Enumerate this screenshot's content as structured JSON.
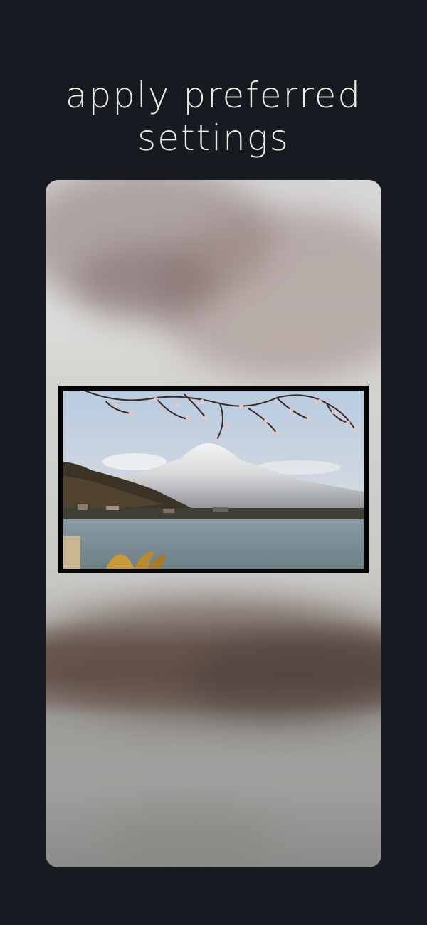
{
  "headline": {
    "line1": "apply preferred",
    "line2": "settings"
  },
  "preview": {
    "background_image": "blurred-cherry-blossom-lake-photo",
    "framed_image": "mount-fuji-lake-cherry-blossom-photo"
  },
  "colors": {
    "background": "#171a20",
    "headline_text": "#ecebe2",
    "frame_border": "#060606"
  }
}
